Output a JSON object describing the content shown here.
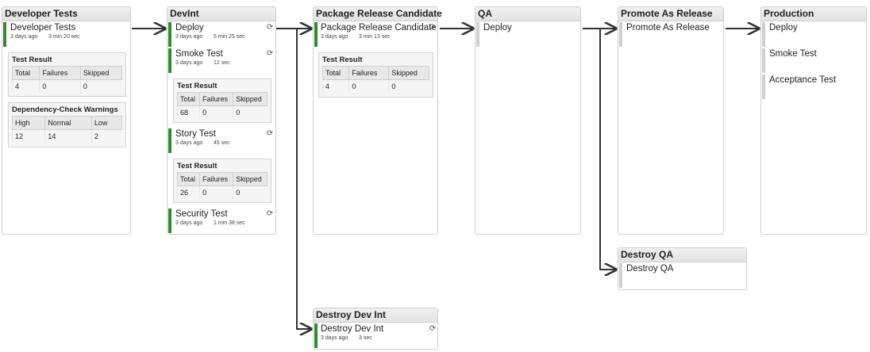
{
  "stages": {
    "developer_tests": {
      "title": "Developer Tests",
      "jobs": [
        {
          "name": "Developer Tests",
          "ago": "3 days ago",
          "duration": "3 min 20 sec"
        }
      ],
      "test_result": {
        "title": "Test Result",
        "headers": [
          "Total",
          "Failures",
          "Skipped"
        ],
        "values": [
          "4",
          "0",
          "0"
        ]
      },
      "dependency": {
        "title": "Dependency-Check Warnings",
        "headers": [
          "High",
          "Normal",
          "Low"
        ],
        "values": [
          "12",
          "14",
          "2"
        ]
      }
    },
    "devint": {
      "title": "DevInt",
      "jobs": [
        {
          "name": "Deploy",
          "ago": "3 days ago",
          "duration": "5 min 25 sec"
        },
        {
          "name": "Smoke Test",
          "ago": "3 days ago",
          "duration": "12 sec"
        },
        {
          "name": "Story Test",
          "ago": "3 days ago",
          "duration": "45 sec"
        },
        {
          "name": "Security Test",
          "ago": "3 days ago",
          "duration": "1 min 38 sec"
        }
      ],
      "smoke_result": {
        "title": "Test Result",
        "headers": [
          "Total",
          "Failures",
          "Skipped"
        ],
        "values": [
          "68",
          "0",
          "0"
        ]
      },
      "story_result": {
        "title": "Test Result",
        "headers": [
          "Total",
          "Failures",
          "Skipped"
        ],
        "values": [
          "26",
          "0",
          "0"
        ]
      }
    },
    "package": {
      "title": "Package Release Candidate",
      "jobs": [
        {
          "name": "Package Release Candidate",
          "ago": "3 days ago",
          "duration": "3 min 13 sec"
        }
      ],
      "test_result": {
        "title": "Test Result",
        "headers": [
          "Total",
          "Failures",
          "Skipped"
        ],
        "values": [
          "4",
          "0",
          "0"
        ]
      }
    },
    "qa": {
      "title": "QA",
      "jobs": [
        {
          "name": "Deploy"
        }
      ]
    },
    "promote": {
      "title": "Promote As Release",
      "jobs": [
        {
          "name": "Promote As Release"
        }
      ]
    },
    "production": {
      "title": "Production",
      "jobs": [
        {
          "name": "Deploy"
        },
        {
          "name": "Smoke Test"
        },
        {
          "name": "Acceptance Test"
        }
      ]
    },
    "destroy_qa": {
      "title": "Destroy QA",
      "jobs": [
        {
          "name": "Destroy QA"
        }
      ]
    },
    "destroy_devint": {
      "title": "Destroy Dev Int",
      "jobs": [
        {
          "name": "Destroy Dev Int",
          "ago": "3 days ago",
          "duration": "3 sec"
        }
      ]
    }
  },
  "colors": {
    "success": "#2e8b2e",
    "pending": "#cfcfcf",
    "arrow": "#333333"
  },
  "icons": {
    "rebuild": "rebuild-icon"
  }
}
